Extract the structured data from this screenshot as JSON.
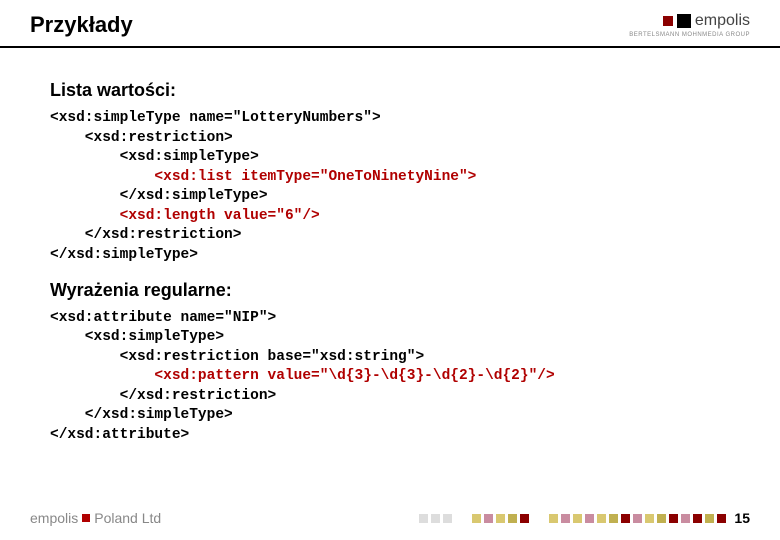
{
  "header": {
    "title": "Przykłady",
    "logo_text": "empolis",
    "logo_sub": "BERTELSMANN MOHNMEDIA GROUP"
  },
  "sections": {
    "s1_heading": "Lista wartości:",
    "s1_code_lines": [
      {
        "indent": 0,
        "pre": "<xsd:simpleType name=\"LotteryNumbers\">",
        "hl": "",
        "post": ""
      },
      {
        "indent": 1,
        "pre": "<xsd:restriction>",
        "hl": "",
        "post": ""
      },
      {
        "indent": 2,
        "pre": "<xsd:simpleType>",
        "hl": "",
        "post": ""
      },
      {
        "indent": 3,
        "pre": "",
        "hl": "<xsd:list itemType=\"OneToNinetyNine\">",
        "post": ""
      },
      {
        "indent": 2,
        "pre": "</xsd:simpleType>",
        "hl": "",
        "post": ""
      },
      {
        "indent": 2,
        "pre": "",
        "hl": "<xsd:length value=\"6\"/>",
        "post": ""
      },
      {
        "indent": 1,
        "pre": "</xsd:restriction>",
        "hl": "",
        "post": ""
      },
      {
        "indent": 0,
        "pre": "</xsd:simpleType>",
        "hl": "",
        "post": ""
      }
    ],
    "s2_heading": "Wyrażenia regularne:",
    "s2_code_lines": [
      {
        "indent": 0,
        "pre": "<xsd:attribute name=\"NIP\">",
        "hl": "",
        "post": ""
      },
      {
        "indent": 1,
        "pre": "<xsd:simpleType>",
        "hl": "",
        "post": ""
      },
      {
        "indent": 2,
        "pre": "<xsd:restriction base=\"xsd:string\">",
        "hl": "",
        "post": ""
      },
      {
        "indent": 3,
        "pre": "",
        "hl": "<xsd:pattern value=\"\\d{3}-\\d{3}-\\d{2}-\\d{2}\"/>",
        "post": ""
      },
      {
        "indent": 2,
        "pre": "</xsd:restriction>",
        "hl": "",
        "post": ""
      },
      {
        "indent": 1,
        "pre": "</xsd:simpleType>",
        "hl": "",
        "post": ""
      },
      {
        "indent": 0,
        "pre": "</xsd:attribute>",
        "hl": "",
        "post": ""
      }
    ]
  },
  "footer": {
    "logo_pre": "empolis",
    "logo_post": "Poland Ltd",
    "page_number": "15",
    "squares": [
      "#ddd",
      "#ddd",
      "#ddd",
      "transparent",
      "#d9c870",
      "#c98ca0",
      "#d9c870",
      "#c0b050",
      "#8b0000",
      "transparent",
      "#d9c870",
      "#c98ca0",
      "#d9c870",
      "#c98ca0",
      "#d9c870",
      "#c0b050",
      "#8b0000",
      "#c98ca0",
      "#d9c870",
      "#c0b050",
      "#8b0000",
      "#c98ca0",
      "#8b0000",
      "#c0b050",
      "#8b0000"
    ]
  }
}
